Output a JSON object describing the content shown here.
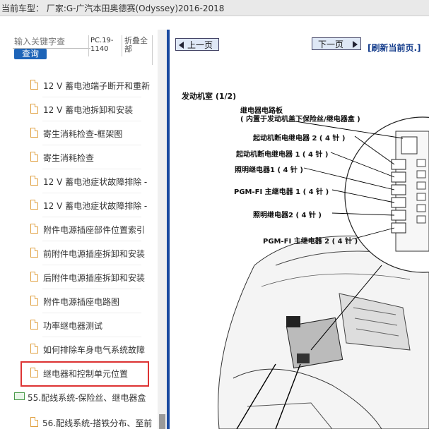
{
  "window": {
    "title": "当前车型：  厂家:G-广汽本田奥德赛(Odyssey)2016-2018"
  },
  "left_panel": {
    "search": {
      "placeholder": "输入关键字查",
      "button_label": "查询"
    },
    "pc_code": "PC.19-1140",
    "fold_all_label": "折叠全部",
    "items": [
      {
        "label": "12 V 蓄电池端子断开和重新"
      },
      {
        "label": "12 V 蓄电池拆卸和安装"
      },
      {
        "label": "寄生消耗检查-框架图"
      },
      {
        "label": "寄生消耗检查"
      },
      {
        "label": "12 V 蓄电池症状故障排除 -"
      },
      {
        "label": "12 V 蓄电池症状故障排除 -"
      },
      {
        "label": "附件电源插座部件位置索引"
      },
      {
        "label": "前附件电源插座拆卸和安装"
      },
      {
        "label": "后附件电源插座拆卸和安装"
      },
      {
        "label": "附件电源插座电路图"
      },
      {
        "label": "功率继电器测试"
      },
      {
        "label": "如何排除车身电气系统故障"
      },
      {
        "label": "继电器和控制单元位置"
      }
    ],
    "folder": {
      "label": "55.配线系统-保险丝、继电器盒"
    },
    "last_item": {
      "label": "56.配线系统-搭铁分布、至前"
    }
  },
  "viewer": {
    "prev_label": "上一页",
    "next_label": "下一页",
    "refresh_label": "[刷新当前页.]"
  },
  "diagram": {
    "title": "发动机室 (1/2)",
    "callouts": [
      {
        "line1": "继电器电路板",
        "line2": "( 内置于发动机盖下保险丝/继电器盒 )"
      },
      {
        "line1": "起动机断电继电器 2 ( 4 针 )"
      },
      {
        "line1": "起动机断电继电器 1 ( 4 针 )"
      },
      {
        "line1": "照明继电器1 ( 4 针 )"
      },
      {
        "line1": "PGM-FI 主继电器 1 ( 4 针 )"
      },
      {
        "line1": "照明继电器2 ( 4 针 )"
      },
      {
        "line1": "PGM-FI 主继电器 2 ( 4 针 )"
      }
    ]
  }
}
